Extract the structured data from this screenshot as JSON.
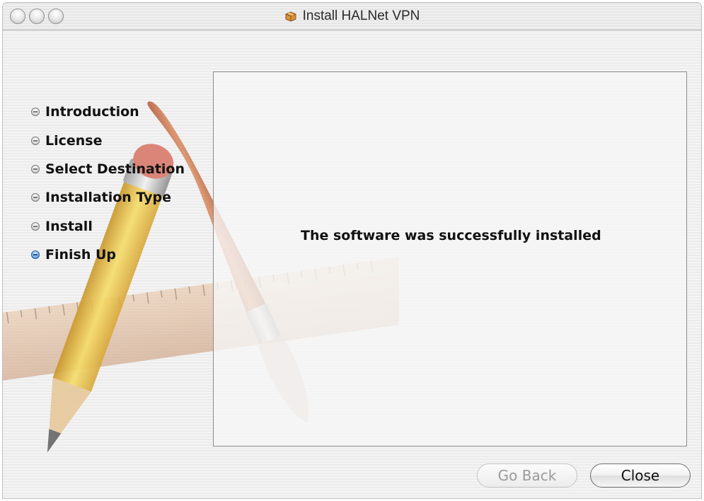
{
  "window": {
    "title": "Install HALNet VPN",
    "title_icon": "package-icon"
  },
  "sidebar": {
    "steps": [
      {
        "label": "Introduction",
        "state": "done"
      },
      {
        "label": "License",
        "state": "done"
      },
      {
        "label": "Select Destination",
        "state": "done"
      },
      {
        "label": "Installation Type",
        "state": "done"
      },
      {
        "label": "Install",
        "state": "done"
      },
      {
        "label": "Finish Up",
        "state": "current"
      }
    ]
  },
  "content": {
    "message": "The software was successfully installed"
  },
  "buttons": {
    "go_back": "Go Back",
    "close": "Close"
  },
  "colors": {
    "active_step_bullet": "#3f7fd6"
  }
}
